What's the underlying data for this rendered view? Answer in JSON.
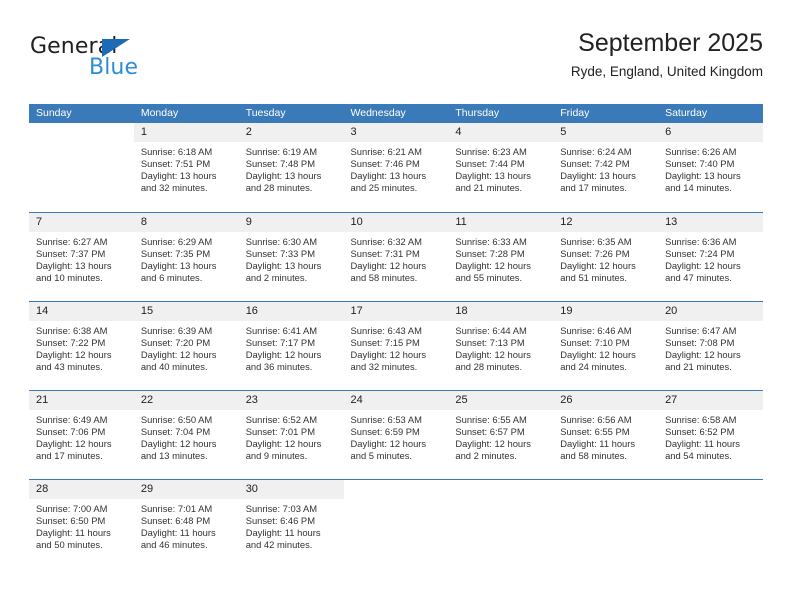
{
  "brand": {
    "name_top": "General",
    "name_bottom": "Blue",
    "triangle_color": "#1b6cb5",
    "blue_color": "#2b8fd6"
  },
  "header": {
    "title": "September 2025",
    "subtitle": "Ryde, England, United Kingdom"
  },
  "theme": {
    "header_blue": "#3b7ab8",
    "day_band_gray": "#f0f0f0",
    "text": "#333333"
  },
  "weekdays": [
    "Sunday",
    "Monday",
    "Tuesday",
    "Wednesday",
    "Thursday",
    "Friday",
    "Saturday"
  ],
  "weeks": [
    [
      {
        "blank": true
      },
      {
        "day": "1",
        "sunrise": "Sunrise: 6:18 AM",
        "sunset": "Sunset: 7:51 PM",
        "daylight1": "Daylight: 13 hours",
        "daylight2": "and 32 minutes."
      },
      {
        "day": "2",
        "sunrise": "Sunrise: 6:19 AM",
        "sunset": "Sunset: 7:48 PM",
        "daylight1": "Daylight: 13 hours",
        "daylight2": "and 28 minutes."
      },
      {
        "day": "3",
        "sunrise": "Sunrise: 6:21 AM",
        "sunset": "Sunset: 7:46 PM",
        "daylight1": "Daylight: 13 hours",
        "daylight2": "and 25 minutes."
      },
      {
        "day": "4",
        "sunrise": "Sunrise: 6:23 AM",
        "sunset": "Sunset: 7:44 PM",
        "daylight1": "Daylight: 13 hours",
        "daylight2": "and 21 minutes."
      },
      {
        "day": "5",
        "sunrise": "Sunrise: 6:24 AM",
        "sunset": "Sunset: 7:42 PM",
        "daylight1": "Daylight: 13 hours",
        "daylight2": "and 17 minutes."
      },
      {
        "day": "6",
        "sunrise": "Sunrise: 6:26 AM",
        "sunset": "Sunset: 7:40 PM",
        "daylight1": "Daylight: 13 hours",
        "daylight2": "and 14 minutes."
      }
    ],
    [
      {
        "day": "7",
        "sunrise": "Sunrise: 6:27 AM",
        "sunset": "Sunset: 7:37 PM",
        "daylight1": "Daylight: 13 hours",
        "daylight2": "and 10 minutes."
      },
      {
        "day": "8",
        "sunrise": "Sunrise: 6:29 AM",
        "sunset": "Sunset: 7:35 PM",
        "daylight1": "Daylight: 13 hours",
        "daylight2": "and 6 minutes."
      },
      {
        "day": "9",
        "sunrise": "Sunrise: 6:30 AM",
        "sunset": "Sunset: 7:33 PM",
        "daylight1": "Daylight: 13 hours",
        "daylight2": "and 2 minutes."
      },
      {
        "day": "10",
        "sunrise": "Sunrise: 6:32 AM",
        "sunset": "Sunset: 7:31 PM",
        "daylight1": "Daylight: 12 hours",
        "daylight2": "and 58 minutes."
      },
      {
        "day": "11",
        "sunrise": "Sunrise: 6:33 AM",
        "sunset": "Sunset: 7:28 PM",
        "daylight1": "Daylight: 12 hours",
        "daylight2": "and 55 minutes."
      },
      {
        "day": "12",
        "sunrise": "Sunrise: 6:35 AM",
        "sunset": "Sunset: 7:26 PM",
        "daylight1": "Daylight: 12 hours",
        "daylight2": "and 51 minutes."
      },
      {
        "day": "13",
        "sunrise": "Sunrise: 6:36 AM",
        "sunset": "Sunset: 7:24 PM",
        "daylight1": "Daylight: 12 hours",
        "daylight2": "and 47 minutes."
      }
    ],
    [
      {
        "day": "14",
        "sunrise": "Sunrise: 6:38 AM",
        "sunset": "Sunset: 7:22 PM",
        "daylight1": "Daylight: 12 hours",
        "daylight2": "and 43 minutes."
      },
      {
        "day": "15",
        "sunrise": "Sunrise: 6:39 AM",
        "sunset": "Sunset: 7:20 PM",
        "daylight1": "Daylight: 12 hours",
        "daylight2": "and 40 minutes."
      },
      {
        "day": "16",
        "sunrise": "Sunrise: 6:41 AM",
        "sunset": "Sunset: 7:17 PM",
        "daylight1": "Daylight: 12 hours",
        "daylight2": "and 36 minutes."
      },
      {
        "day": "17",
        "sunrise": "Sunrise: 6:43 AM",
        "sunset": "Sunset: 7:15 PM",
        "daylight1": "Daylight: 12 hours",
        "daylight2": "and 32 minutes."
      },
      {
        "day": "18",
        "sunrise": "Sunrise: 6:44 AM",
        "sunset": "Sunset: 7:13 PM",
        "daylight1": "Daylight: 12 hours",
        "daylight2": "and 28 minutes."
      },
      {
        "day": "19",
        "sunrise": "Sunrise: 6:46 AM",
        "sunset": "Sunset: 7:10 PM",
        "daylight1": "Daylight: 12 hours",
        "daylight2": "and 24 minutes."
      },
      {
        "day": "20",
        "sunrise": "Sunrise: 6:47 AM",
        "sunset": "Sunset: 7:08 PM",
        "daylight1": "Daylight: 12 hours",
        "daylight2": "and 21 minutes."
      }
    ],
    [
      {
        "day": "21",
        "sunrise": "Sunrise: 6:49 AM",
        "sunset": "Sunset: 7:06 PM",
        "daylight1": "Daylight: 12 hours",
        "daylight2": "and 17 minutes."
      },
      {
        "day": "22",
        "sunrise": "Sunrise: 6:50 AM",
        "sunset": "Sunset: 7:04 PM",
        "daylight1": "Daylight: 12 hours",
        "daylight2": "and 13 minutes."
      },
      {
        "day": "23",
        "sunrise": "Sunrise: 6:52 AM",
        "sunset": "Sunset: 7:01 PM",
        "daylight1": "Daylight: 12 hours",
        "daylight2": "and 9 minutes."
      },
      {
        "day": "24",
        "sunrise": "Sunrise: 6:53 AM",
        "sunset": "Sunset: 6:59 PM",
        "daylight1": "Daylight: 12 hours",
        "daylight2": "and 5 minutes."
      },
      {
        "day": "25",
        "sunrise": "Sunrise: 6:55 AM",
        "sunset": "Sunset: 6:57 PM",
        "daylight1": "Daylight: 12 hours",
        "daylight2": "and 2 minutes."
      },
      {
        "day": "26",
        "sunrise": "Sunrise: 6:56 AM",
        "sunset": "Sunset: 6:55 PM",
        "daylight1": "Daylight: 11 hours",
        "daylight2": "and 58 minutes."
      },
      {
        "day": "27",
        "sunrise": "Sunrise: 6:58 AM",
        "sunset": "Sunset: 6:52 PM",
        "daylight1": "Daylight: 11 hours",
        "daylight2": "and 54 minutes."
      }
    ],
    [
      {
        "day": "28",
        "sunrise": "Sunrise: 7:00 AM",
        "sunset": "Sunset: 6:50 PM",
        "daylight1": "Daylight: 11 hours",
        "daylight2": "and 50 minutes."
      },
      {
        "day": "29",
        "sunrise": "Sunrise: 7:01 AM",
        "sunset": "Sunset: 6:48 PM",
        "daylight1": "Daylight: 11 hours",
        "daylight2": "and 46 minutes."
      },
      {
        "day": "30",
        "sunrise": "Sunrise: 7:03 AM",
        "sunset": "Sunset: 6:46 PM",
        "daylight1": "Daylight: 11 hours",
        "daylight2": "and 42 minutes."
      },
      {
        "blank": true
      },
      {
        "blank": true
      },
      {
        "blank": true
      },
      {
        "blank": true
      }
    ]
  ]
}
